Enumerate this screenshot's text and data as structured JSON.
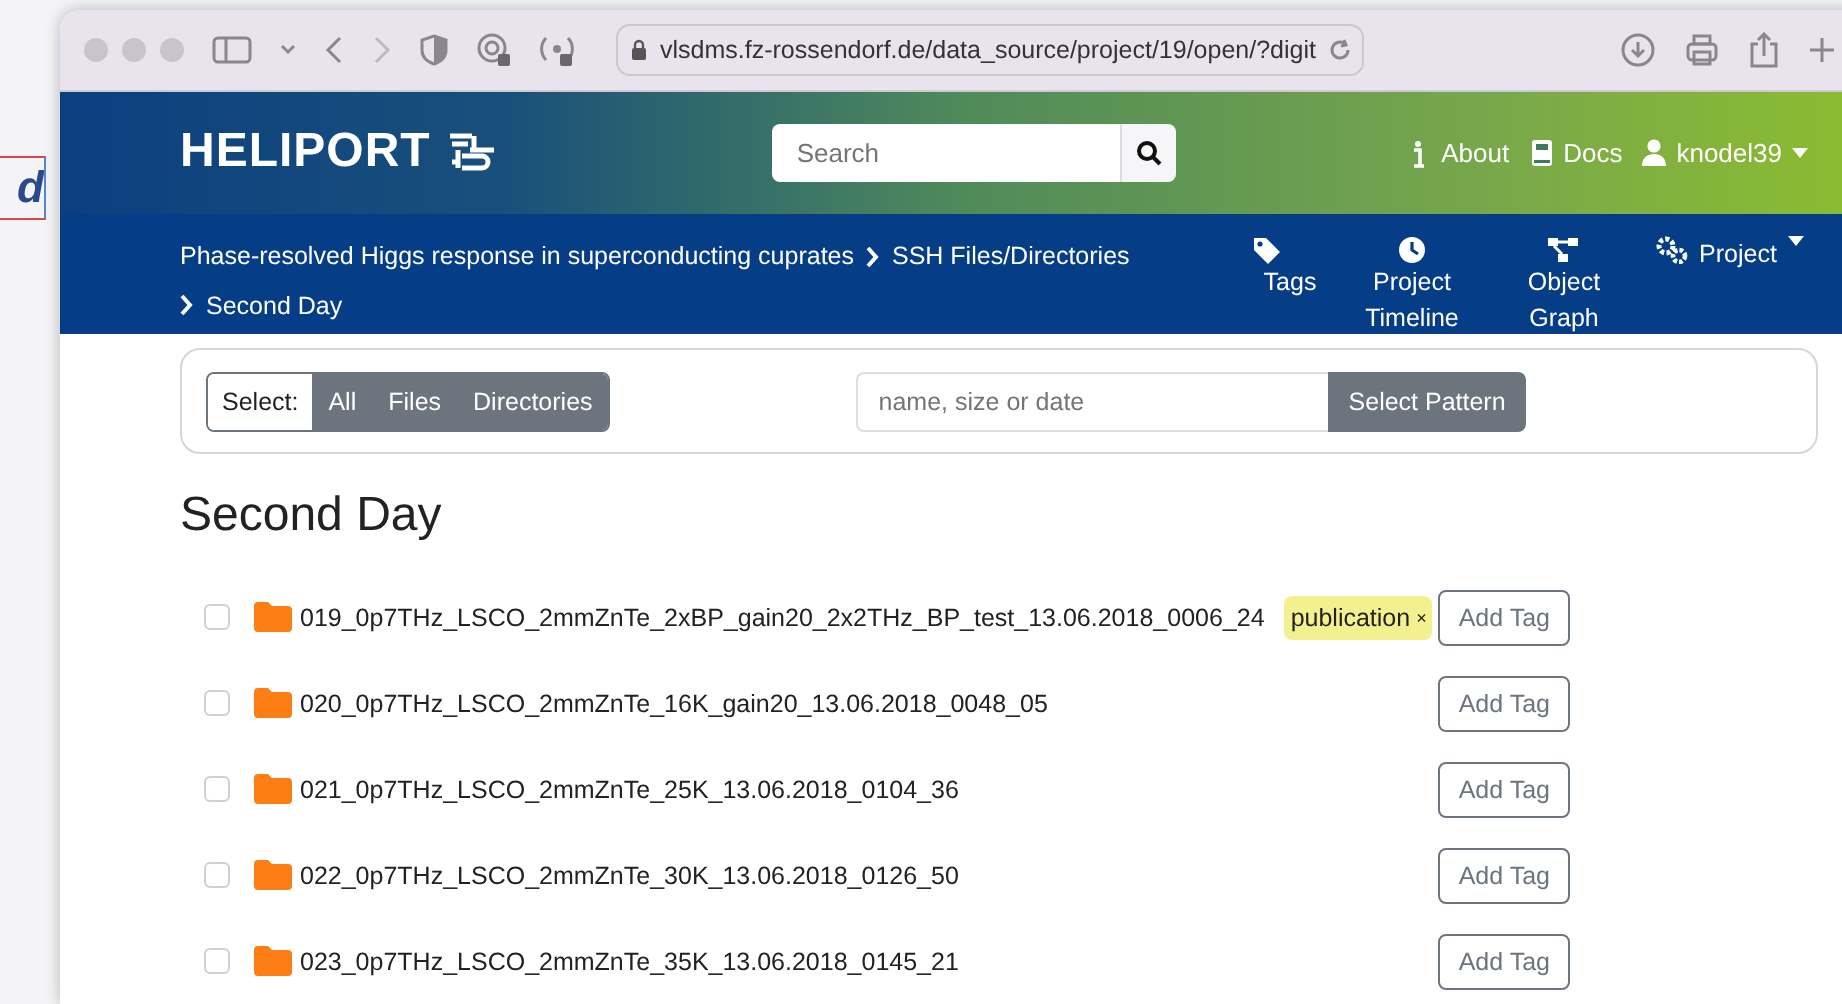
{
  "background_window": {
    "fragment": "d"
  },
  "browser": {
    "url": "vlsdms.fz-rossendorf.de/data_source/project/19/open/?digit"
  },
  "header": {
    "brand": "HELIPORT",
    "search": {
      "placeholder": "Search"
    },
    "links": [
      {
        "label": "About",
        "kind": "info"
      },
      {
        "label": "Docs",
        "kind": "book"
      },
      {
        "label": "knodel39",
        "kind": "user"
      }
    ]
  },
  "breadcrumb": [
    "Phase-resolved Higgs response in superconducting cuprates",
    "SSH Files/Directories",
    "Second Day"
  ],
  "nav": [
    {
      "label": "Tags",
      "kind": "tag"
    },
    {
      "label": "Project Timeline",
      "kind": "clock"
    },
    {
      "label": "Object Graph",
      "kind": "graph"
    },
    {
      "label": "Project",
      "kind": "gears"
    }
  ],
  "select_bar": {
    "label": "Select:",
    "buttons": [
      "All",
      "Files",
      "Directories"
    ],
    "pattern": {
      "placeholder": "name, size or date"
    },
    "pattern_button": "Select Pattern"
  },
  "heading": "Second Day",
  "rows": [
    {
      "name": "019_0p7THz_LSCO_2mmZnTe_2xBP_gain20_2x2THz_BP_test_13.06.2018_0006_24",
      "checked": false,
      "tags": [
        {
          "label": "publication",
          "remove": "×"
        }
      ],
      "action": "Add Tag"
    },
    {
      "name": "020_0p7THz_LSCO_2mmZnTe_16K_gain20_13.06.2018_0048_05",
      "checked": false,
      "tags": [],
      "action": "Add Tag"
    },
    {
      "name": "021_0p7THz_LSCO_2mmZnTe_25K_13.06.2018_0104_36",
      "checked": false,
      "tags": [],
      "action": "Add Tag"
    },
    {
      "name": "022_0p7THz_LSCO_2mmZnTe_30K_13.06.2018_0126_50",
      "checked": false,
      "tags": [],
      "action": "Add Tag"
    },
    {
      "name": "023_0p7THz_LSCO_2mmZnTe_35K_13.06.2018_0145_21",
      "checked": false,
      "tags": [],
      "action": "Add Tag"
    }
  ]
}
